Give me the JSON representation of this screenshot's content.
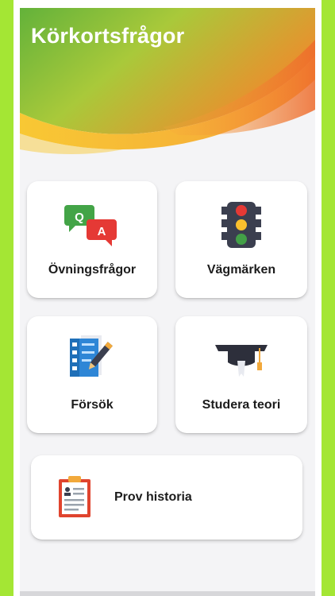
{
  "app": {
    "title": "Körkortsfrågor"
  },
  "menu": {
    "practice": {
      "label": "Övningsfrågor",
      "icon": "qa-chat-icon"
    },
    "signs": {
      "label": "Vägmärken",
      "icon": "traffic-light-icon"
    },
    "attempts": {
      "label": "Försök",
      "icon": "edit-document-icon"
    },
    "theory": {
      "label": "Studera teori",
      "icon": "graduation-cap-icon"
    },
    "history": {
      "label": "Prov historia",
      "icon": "clipboard-icon"
    }
  },
  "icon_text": {
    "q": "Q",
    "a": "A"
  },
  "colors": {
    "frame": "#a4e634",
    "header_green": "#6db53a",
    "header_orange": "#f07a2a",
    "header_yellow": "#f7c531"
  }
}
